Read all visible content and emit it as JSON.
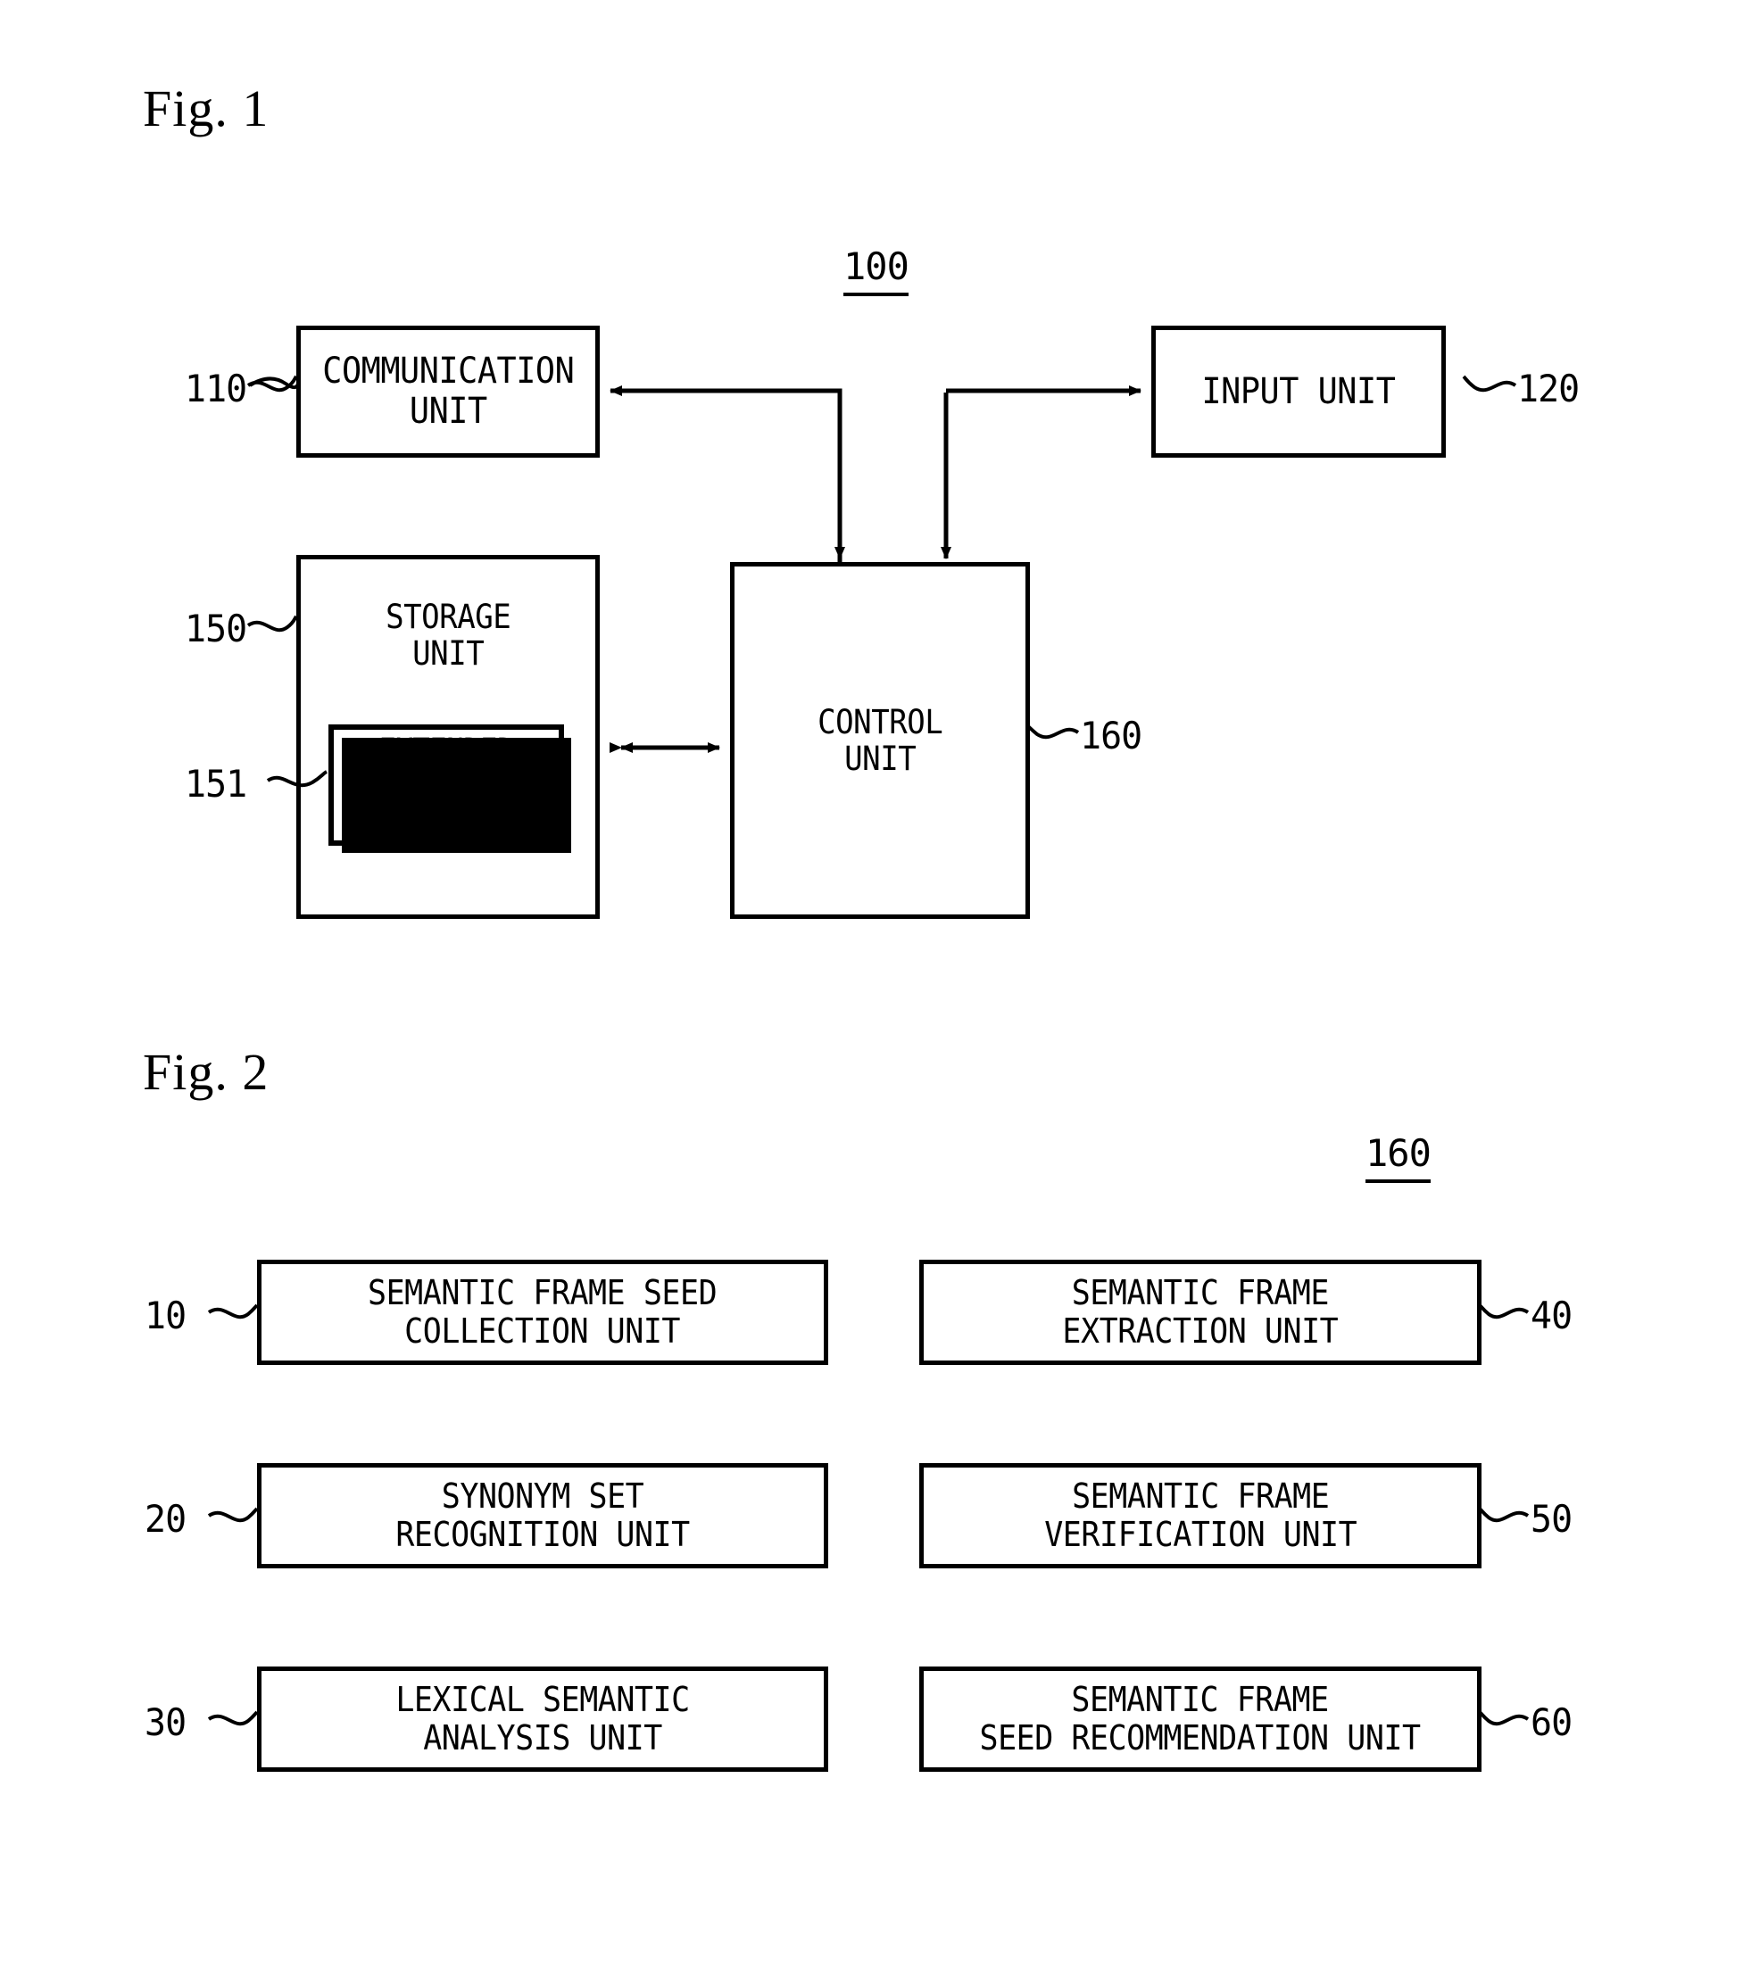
{
  "figure1": {
    "title": "Fig. 1",
    "system_ref": "100",
    "blocks": [
      {
        "id": "communication-unit",
        "label": "COMMUNICATION\nUNIT",
        "ref": "110"
      },
      {
        "id": "input-unit",
        "label": "INPUT UNIT",
        "ref": "120"
      },
      {
        "id": "storage-unit",
        "label": "STORAGE\nUNIT",
        "ref": "150"
      },
      {
        "id": "extended-semantic-frame",
        "label": "EXTENDED\nSEMANTIC\nFRAME",
        "ref": "151"
      },
      {
        "id": "control-unit",
        "label": "CONTROL\nUNIT",
        "ref": "160"
      }
    ]
  },
  "figure2": {
    "title": "Fig. 2",
    "control_unit_ref": "160",
    "left_column": [
      {
        "id": "semantic-frame-seed-collection-unit",
        "label": "SEMANTIC FRAME SEED\nCOLLECTION UNIT",
        "ref": "10"
      },
      {
        "id": "synonym-set-recognition-unit",
        "label": "SYNONYM SET\nRECOGNITION UNIT",
        "ref": "20"
      },
      {
        "id": "lexical-semantic-analysis-unit",
        "label": "LEXICAL SEMANTIC\nANALYSIS UNIT",
        "ref": "30"
      }
    ],
    "right_column": [
      {
        "id": "semantic-frame-extraction-unit",
        "label": "SEMANTIC FRAME\nEXTRACTION UNIT",
        "ref": "40"
      },
      {
        "id": "semantic-frame-verification-unit",
        "label": "SEMANTIC FRAME\nVERIFICATION UNIT",
        "ref": "50"
      },
      {
        "id": "semantic-frame-seed-recommendation-unit",
        "label": "SEMANTIC FRAME\nSEED RECOMMENDATION UNIT",
        "ref": "60"
      }
    ]
  },
  "colors": {
    "ink": "#000000",
    "paper": "#ffffff"
  }
}
